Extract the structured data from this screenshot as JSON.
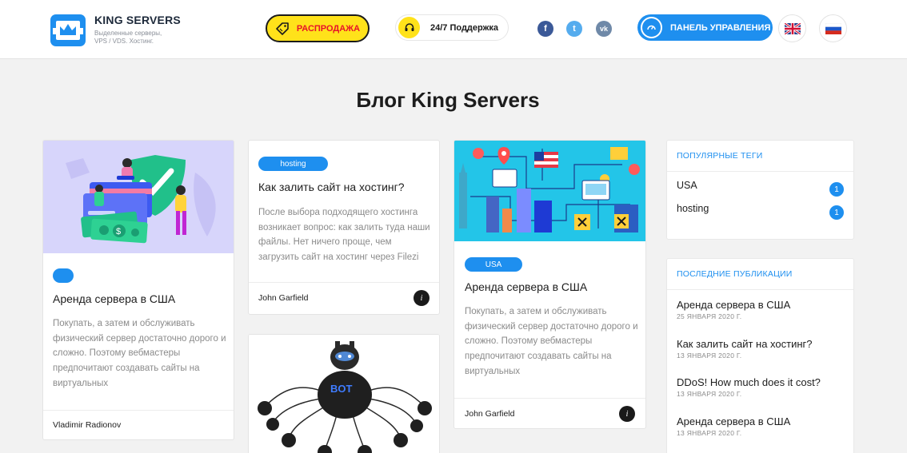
{
  "header": {
    "brand_name": "KING SERVERS",
    "brand_tagline": "Выделенные серверы, VPS / VDS. Хостинг.",
    "sale_label": "РАСПРОДАЖА",
    "support_label": "24/7 Поддержка",
    "social": [
      {
        "name": "facebook",
        "glyph": "f"
      },
      {
        "name": "twitter",
        "glyph": "t"
      },
      {
        "name": "vk",
        "glyph": "vk"
      }
    ],
    "panel_label": "ПАНЕЛЬ УПРАВЛЕНИЯ",
    "languages": [
      "en",
      "ru"
    ]
  },
  "page_title": "Блог King Servers",
  "posts": [
    {
      "tag": "",
      "title": "Аренда сервера в США",
      "excerpt": "Покупать, а затем и обслуживать физический сервер достаточно дорого и сложно. Поэтому вебмастеры предпочитают создавать сайты на виртуальных",
      "author": "Vladimir Radionov"
    },
    {
      "tag": "hosting",
      "title": "Как залить сайт на хостинг?",
      "excerpt": "После выбора подходящего хостинга возникает вопрос: как залить туда наши файлы. Нет ничего проще, чем загрузить сайт на хостинг через Filezi",
      "author": "John Garfield",
      "info_glyph": "i"
    },
    {
      "tag": "USA",
      "title": "Аренда сервера в США",
      "excerpt": "Покупать, а затем и обслуживать физический сервер достаточно дорого и сложно. Поэтому вебмастеры предпочитают создавать сайты на виртуальных",
      "author": "John Garfield",
      "info_glyph": "i"
    },
    {
      "image_text": "BOT"
    }
  ],
  "sidebar": {
    "popular_tags_title": "ПОПУЛЯРНЫЕ ТЕГИ",
    "tags": [
      {
        "name": "USA",
        "count": "1"
      },
      {
        "name": "hosting",
        "count": "1"
      }
    ],
    "recent_title": "ПОСЛЕДНИЕ ПУБЛИКАЦИИ",
    "recent": [
      {
        "title": "Аренда сервера в США",
        "date": "25 ЯНВАРЯ 2020 Г."
      },
      {
        "title": "Как залить сайт на хостинг?",
        "date": "13 ЯНВАРЯ 2020 Г."
      },
      {
        "title": "DDoS! How much does it cost?",
        "date": "13 ЯНВАРЯ 2020 Г."
      },
      {
        "title": "Аренда сервера в США",
        "date": "13 ЯНВАРЯ 2020 Г."
      }
    ]
  },
  "colors": {
    "accent": "#1e8fef",
    "sale_yellow": "#ffe21a",
    "sale_red": "#e8122a",
    "background": "#f2f2f2"
  }
}
